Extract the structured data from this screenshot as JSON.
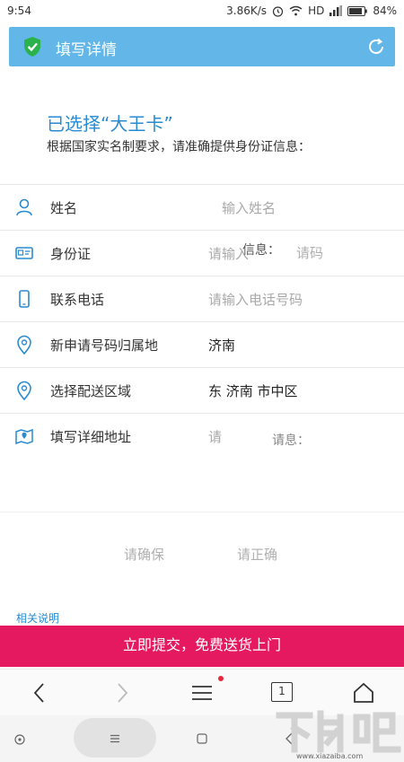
{
  "status_bar": {
    "time": "9:54",
    "speed": "3.86K/s",
    "network": "HD",
    "battery": "84%"
  },
  "header": {
    "title": "填写详情"
  },
  "heading": "已选择“大王卡”",
  "subheading": "根据国家实名制要求，请准确提供身份证信息：",
  "form": {
    "rows": [
      {
        "label": "姓名",
        "placeholder": "输入姓名",
        "icon": "person-icon"
      },
      {
        "label": "身份证",
        "placeholder": "请输入",
        "icon": "id-card-icon"
      },
      {
        "label": "联系电话",
        "placeholder": "请输入电话号码",
        "icon": "phone-icon"
      },
      {
        "label": "新申请号码归属地",
        "value": "济南",
        "icon": "location-pin-icon"
      },
      {
        "label": "选择配送区域",
        "value": "东 济南 市中区",
        "icon": "location-pin-icon"
      },
      {
        "label": "填写详细地址",
        "placeholder": "请",
        "icon": "map-icon"
      }
    ]
  },
  "ghost_texts": {
    "id_mid": "信息：",
    "id_end": "请码",
    "addr_mid": "请息：",
    "confirm_left": "请确保",
    "confirm_right": "请正确"
  },
  "related_link": "相关说明",
  "submit_label": "立即提交，免费送货上门",
  "browser_bar": {
    "tab_count": "1"
  },
  "watermark": {
    "text": "下载吧",
    "url": "www.xiazaiba.com"
  },
  "colors": {
    "title_bar": "#62b7e8",
    "heading": "#2a8bd0",
    "submit": "#e5195f",
    "icon_blue": "#2a8bd0"
  }
}
